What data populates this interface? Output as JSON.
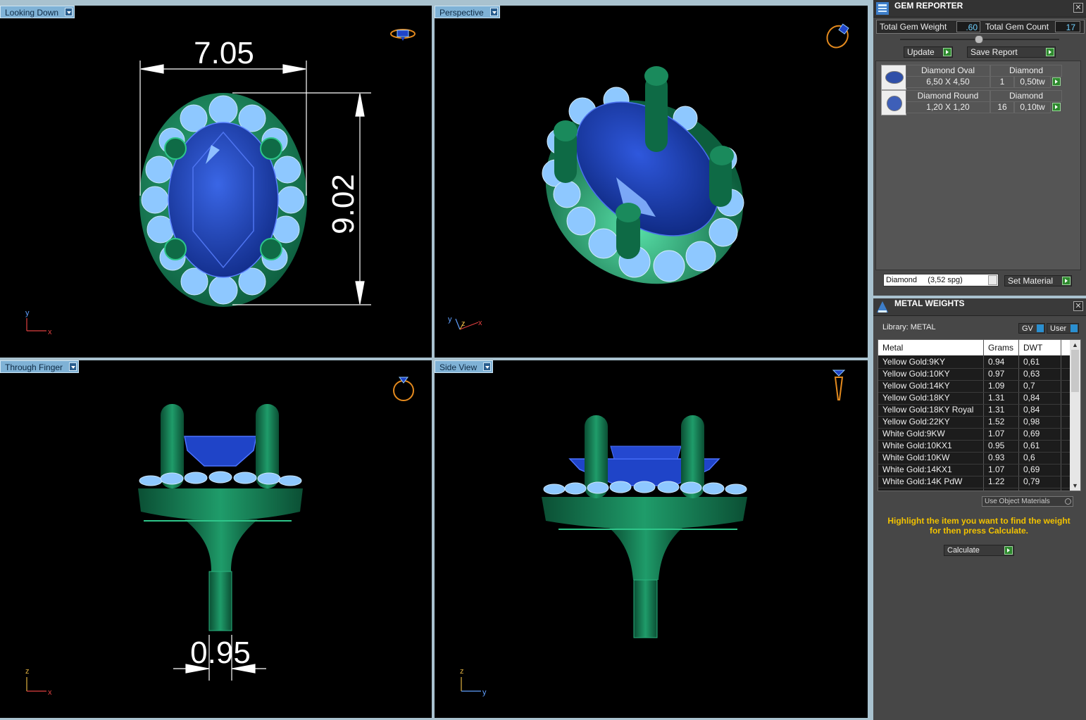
{
  "viewports": [
    {
      "id": "top-left",
      "label": "Looking Down",
      "dimension_w": "7.05",
      "dimension_h": "9.02"
    },
    {
      "id": "top-right",
      "label": "Perspective"
    },
    {
      "id": "bottom-left",
      "label": "Through Finger",
      "dimension": "0.95"
    },
    {
      "id": "bottom-right",
      "label": "Side View"
    }
  ],
  "axes": {
    "x": "x",
    "y": "y",
    "z": "z"
  },
  "gem_reporter": {
    "title": "GEM REPORTER",
    "total_weight_label": "Total Gem Weight",
    "total_weight": ".60",
    "total_count_label": "Total Gem Count",
    "total_count": "17",
    "update_label": "Update",
    "save_report_label": "Save Report",
    "gems": [
      {
        "name": "Diamond Oval",
        "type": "Diamond",
        "size": "6,50 X 4,50",
        "qty": "1",
        "weight": "0,50tw"
      },
      {
        "name": "Diamond Round",
        "type": "Diamond",
        "size": "1,20 X 1,20",
        "qty": "16",
        "weight": "0,10tw"
      }
    ],
    "material_select": "Diamond     (3,52 spg)",
    "set_material_label": "Set Material"
  },
  "metal_weights": {
    "title": "METAL WEIGHTS",
    "library_label": "Library: METAL",
    "gv_label": "GV",
    "user_label": "User",
    "columns": [
      "Metal",
      "Grams",
      "DWT"
    ],
    "rows": [
      [
        "Yellow Gold:9KY",
        "0.94",
        "0,61"
      ],
      [
        "Yellow Gold:10KY",
        "0.97",
        "0,63"
      ],
      [
        "Yellow Gold:14KY",
        "1.09",
        "0,7"
      ],
      [
        "Yellow Gold:18KY",
        "1.31",
        "0,84"
      ],
      [
        "Yellow Gold:18KY Royal",
        "1.31",
        "0,84"
      ],
      [
        "Yellow Gold:22KY",
        "1.52",
        "0,98"
      ],
      [
        "White Gold:9KW",
        "1.07",
        "0,69"
      ],
      [
        "White Gold:10KX1",
        "0.95",
        "0,61"
      ],
      [
        "White Gold:10KW",
        "0.93",
        "0,6"
      ],
      [
        "White Gold:14KX1",
        "1.07",
        "0,69"
      ],
      [
        "White Gold:14K PdW",
        "1.22",
        "0,79"
      ]
    ],
    "use_object_materials_label": "Use Object Materials",
    "hint": "Highlight the item you want to find the weight for then press Calculate.",
    "calculate_label": "Calculate"
  },
  "colors": {
    "metal": "#17855a",
    "gem": "#1f44c8",
    "diamond": "#8ec8ff",
    "label_bg": "#7fb2d6",
    "panel": "#474747",
    "hint": "#f2c200"
  }
}
